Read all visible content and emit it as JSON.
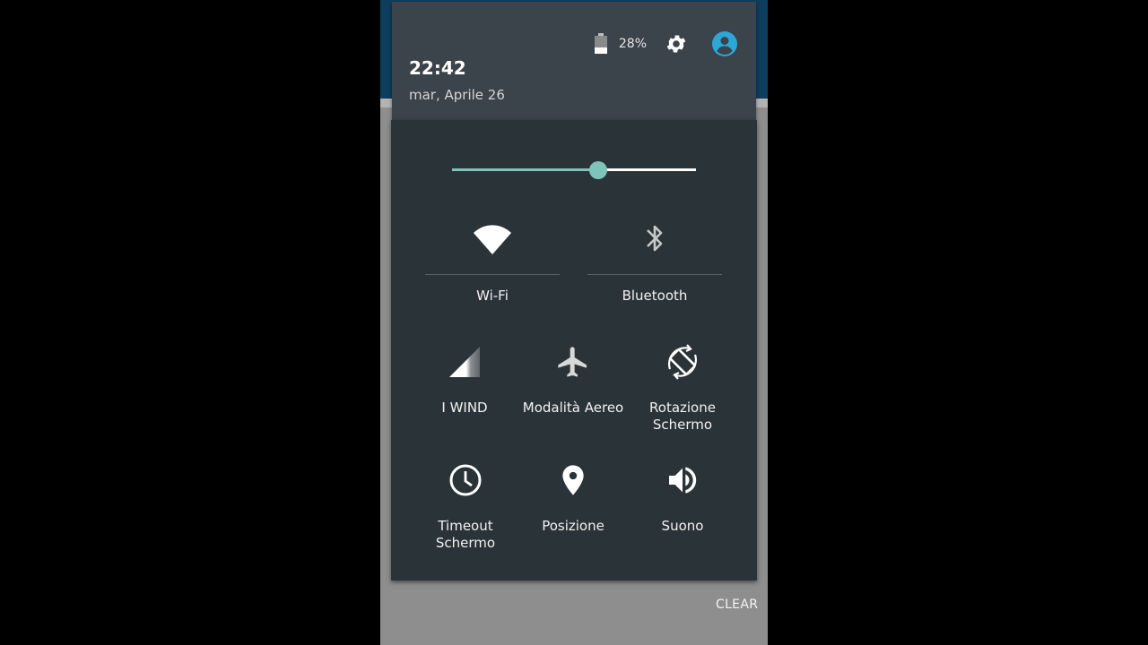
{
  "status": {
    "battery_percent": "28%",
    "time": "22:42",
    "date": "mar, Aprile 26"
  },
  "brightness": {
    "level": 0.6
  },
  "tiles_large": [
    {
      "label": "Wi-Fi",
      "icon": "wifi-icon"
    },
    {
      "label": "Bluetooth",
      "icon": "bluetooth-icon"
    }
  ],
  "tiles": [
    {
      "label": "I WIND",
      "icon": "cell-signal-icon"
    },
    {
      "label": "Modalità Aereo",
      "icon": "airplane-icon"
    },
    {
      "label_line1": "Rotazione",
      "label_line2": "Schermo",
      "icon": "rotation-icon"
    },
    {
      "label_line1": "Timeout",
      "label_line2": "Schermo",
      "icon": "clock-icon"
    },
    {
      "label": "Posizione",
      "icon": "location-icon"
    },
    {
      "label": "Suono",
      "icon": "volume-icon"
    }
  ],
  "footer": {
    "clear_label": "CLEAR"
  },
  "colors": {
    "accent": "#7ec4bb",
    "panel": "#2a3338",
    "header": "#3b434b",
    "account": "#2ea7d6"
  }
}
